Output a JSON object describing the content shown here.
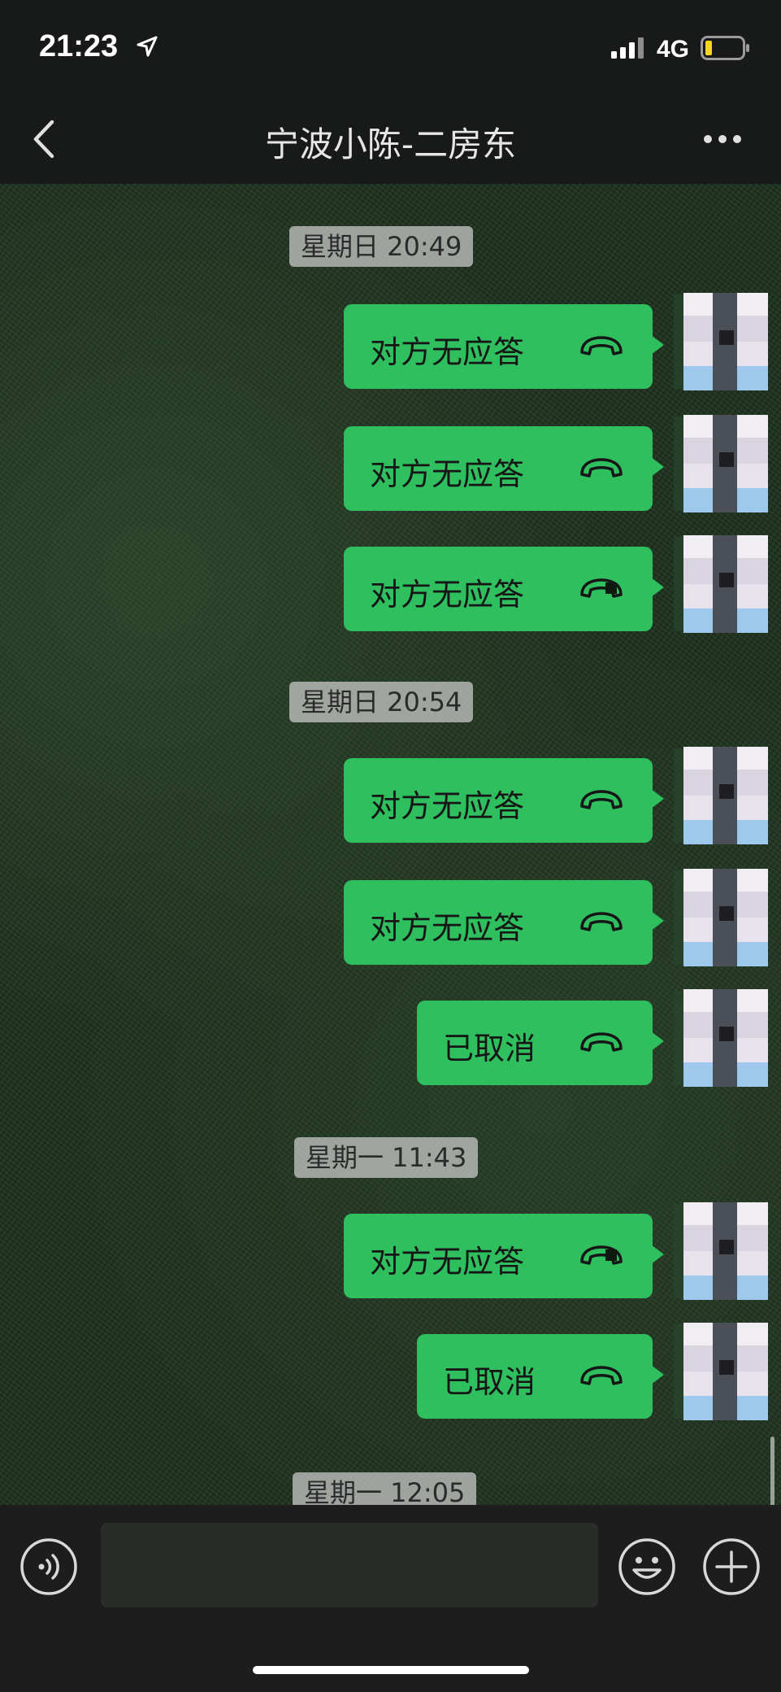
{
  "status_bar": {
    "time": "21:23",
    "network": "4G",
    "icons": [
      "location-arrow-icon",
      "signal-icon",
      "battery-icon"
    ],
    "battery_color": "#f5d426"
  },
  "nav": {
    "title": "宁波小陈-二房东",
    "icons": [
      "back-chevron-icon",
      "more-icon"
    ]
  },
  "chat": {
    "timestamps": [
      "星期日 20:49",
      "星期日 20:54",
      "星期一 11:43",
      "星期一 12:05"
    ],
    "messages": [
      {
        "text": "对方无应答",
        "icon": "phone-hangup-icon"
      },
      {
        "text": "对方无应答",
        "icon": "phone-hangup-icon"
      },
      {
        "text": "对方无应答",
        "icon": "phone-hangup-icon"
      },
      {
        "text": "对方无应答",
        "icon": "phone-hangup-icon"
      },
      {
        "text": "对方无应答",
        "icon": "phone-hangup-icon"
      },
      {
        "text": "已取消",
        "icon": "phone-hangup-icon"
      },
      {
        "text": "对方无应答",
        "icon": "phone-hangup-icon"
      },
      {
        "text": "已取消",
        "icon": "phone-hangup-icon"
      }
    ],
    "bubble_color": "#2fbf5f"
  },
  "input_bar": {
    "placeholder": "",
    "icons": [
      "voice-icon",
      "emoji-icon",
      "plus-icon"
    ]
  }
}
